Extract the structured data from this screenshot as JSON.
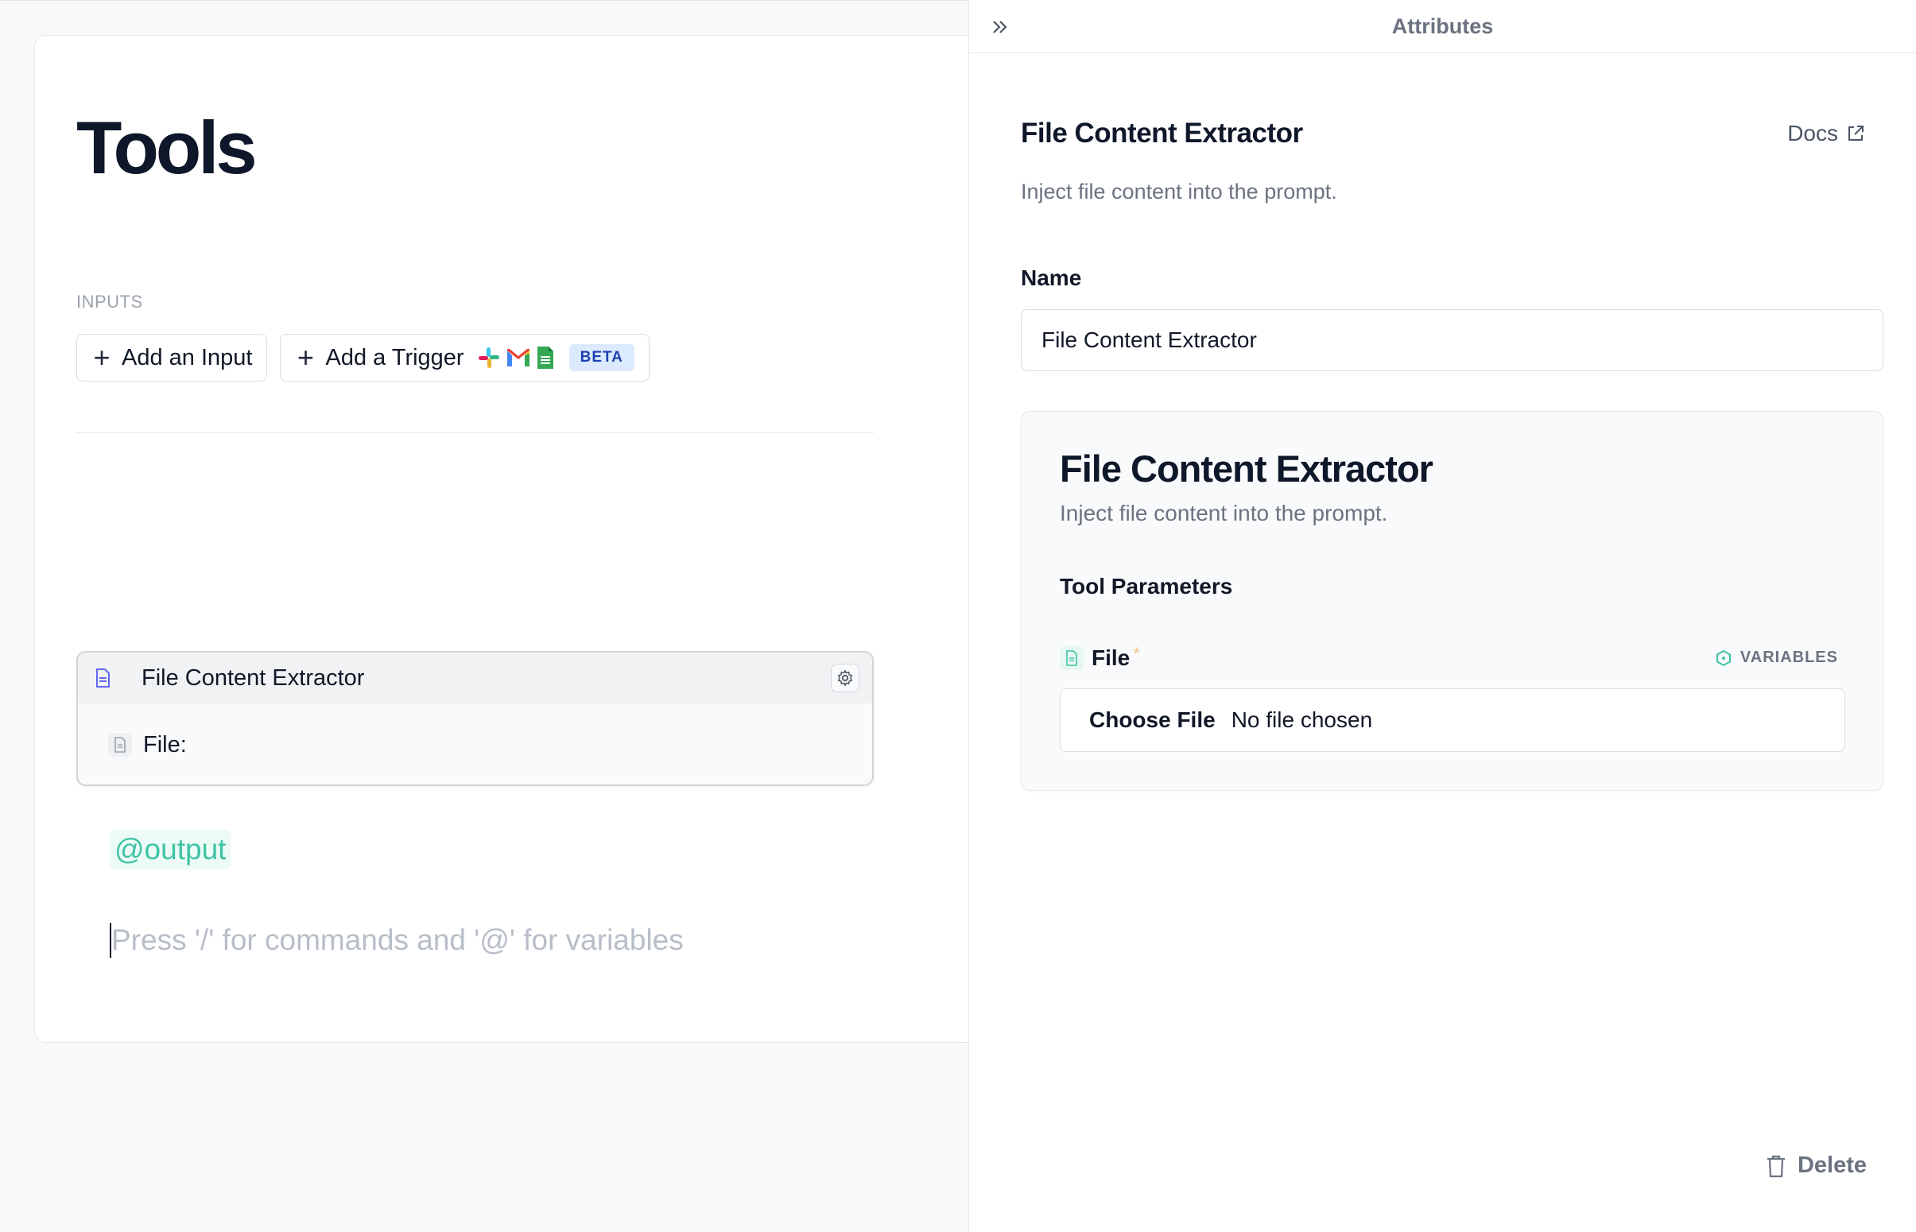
{
  "editor": {
    "title": "Tools",
    "inputs_label": "INPUTS",
    "add_input_label": "Add an Input",
    "add_trigger_label": "Add a Trigger",
    "beta_label": "BETA",
    "trigger_logos": [
      "slack-logo",
      "gmail-logo",
      "google-sheets-logo"
    ],
    "tool_block": {
      "name": "File Content Extractor",
      "param_label": "File:"
    },
    "output_tag": "@output",
    "command_placeholder": "Press '/' for commands and '@' for variables"
  },
  "panel": {
    "header_title": "Attributes",
    "tool_name": "File Content Extractor",
    "docs_label": "Docs",
    "description": "Inject file content into the prompt.",
    "name_label": "Name",
    "name_value": "File Content Extractor",
    "preview": {
      "title": "File Content Extractor",
      "description": "Inject file content into the prompt.",
      "params_label": "Tool Parameters",
      "file_label": "File",
      "required_mark": "*",
      "variables_label": "VARIABLES",
      "choose_file_label": "Choose File",
      "no_file_label": "No file chosen"
    },
    "delete_label": "Delete"
  },
  "colors": {
    "accent_teal": "#3fc3a4",
    "beta_bg": "#dbeafe",
    "beta_text": "#1e40af",
    "muted_text": "#6b7280"
  }
}
